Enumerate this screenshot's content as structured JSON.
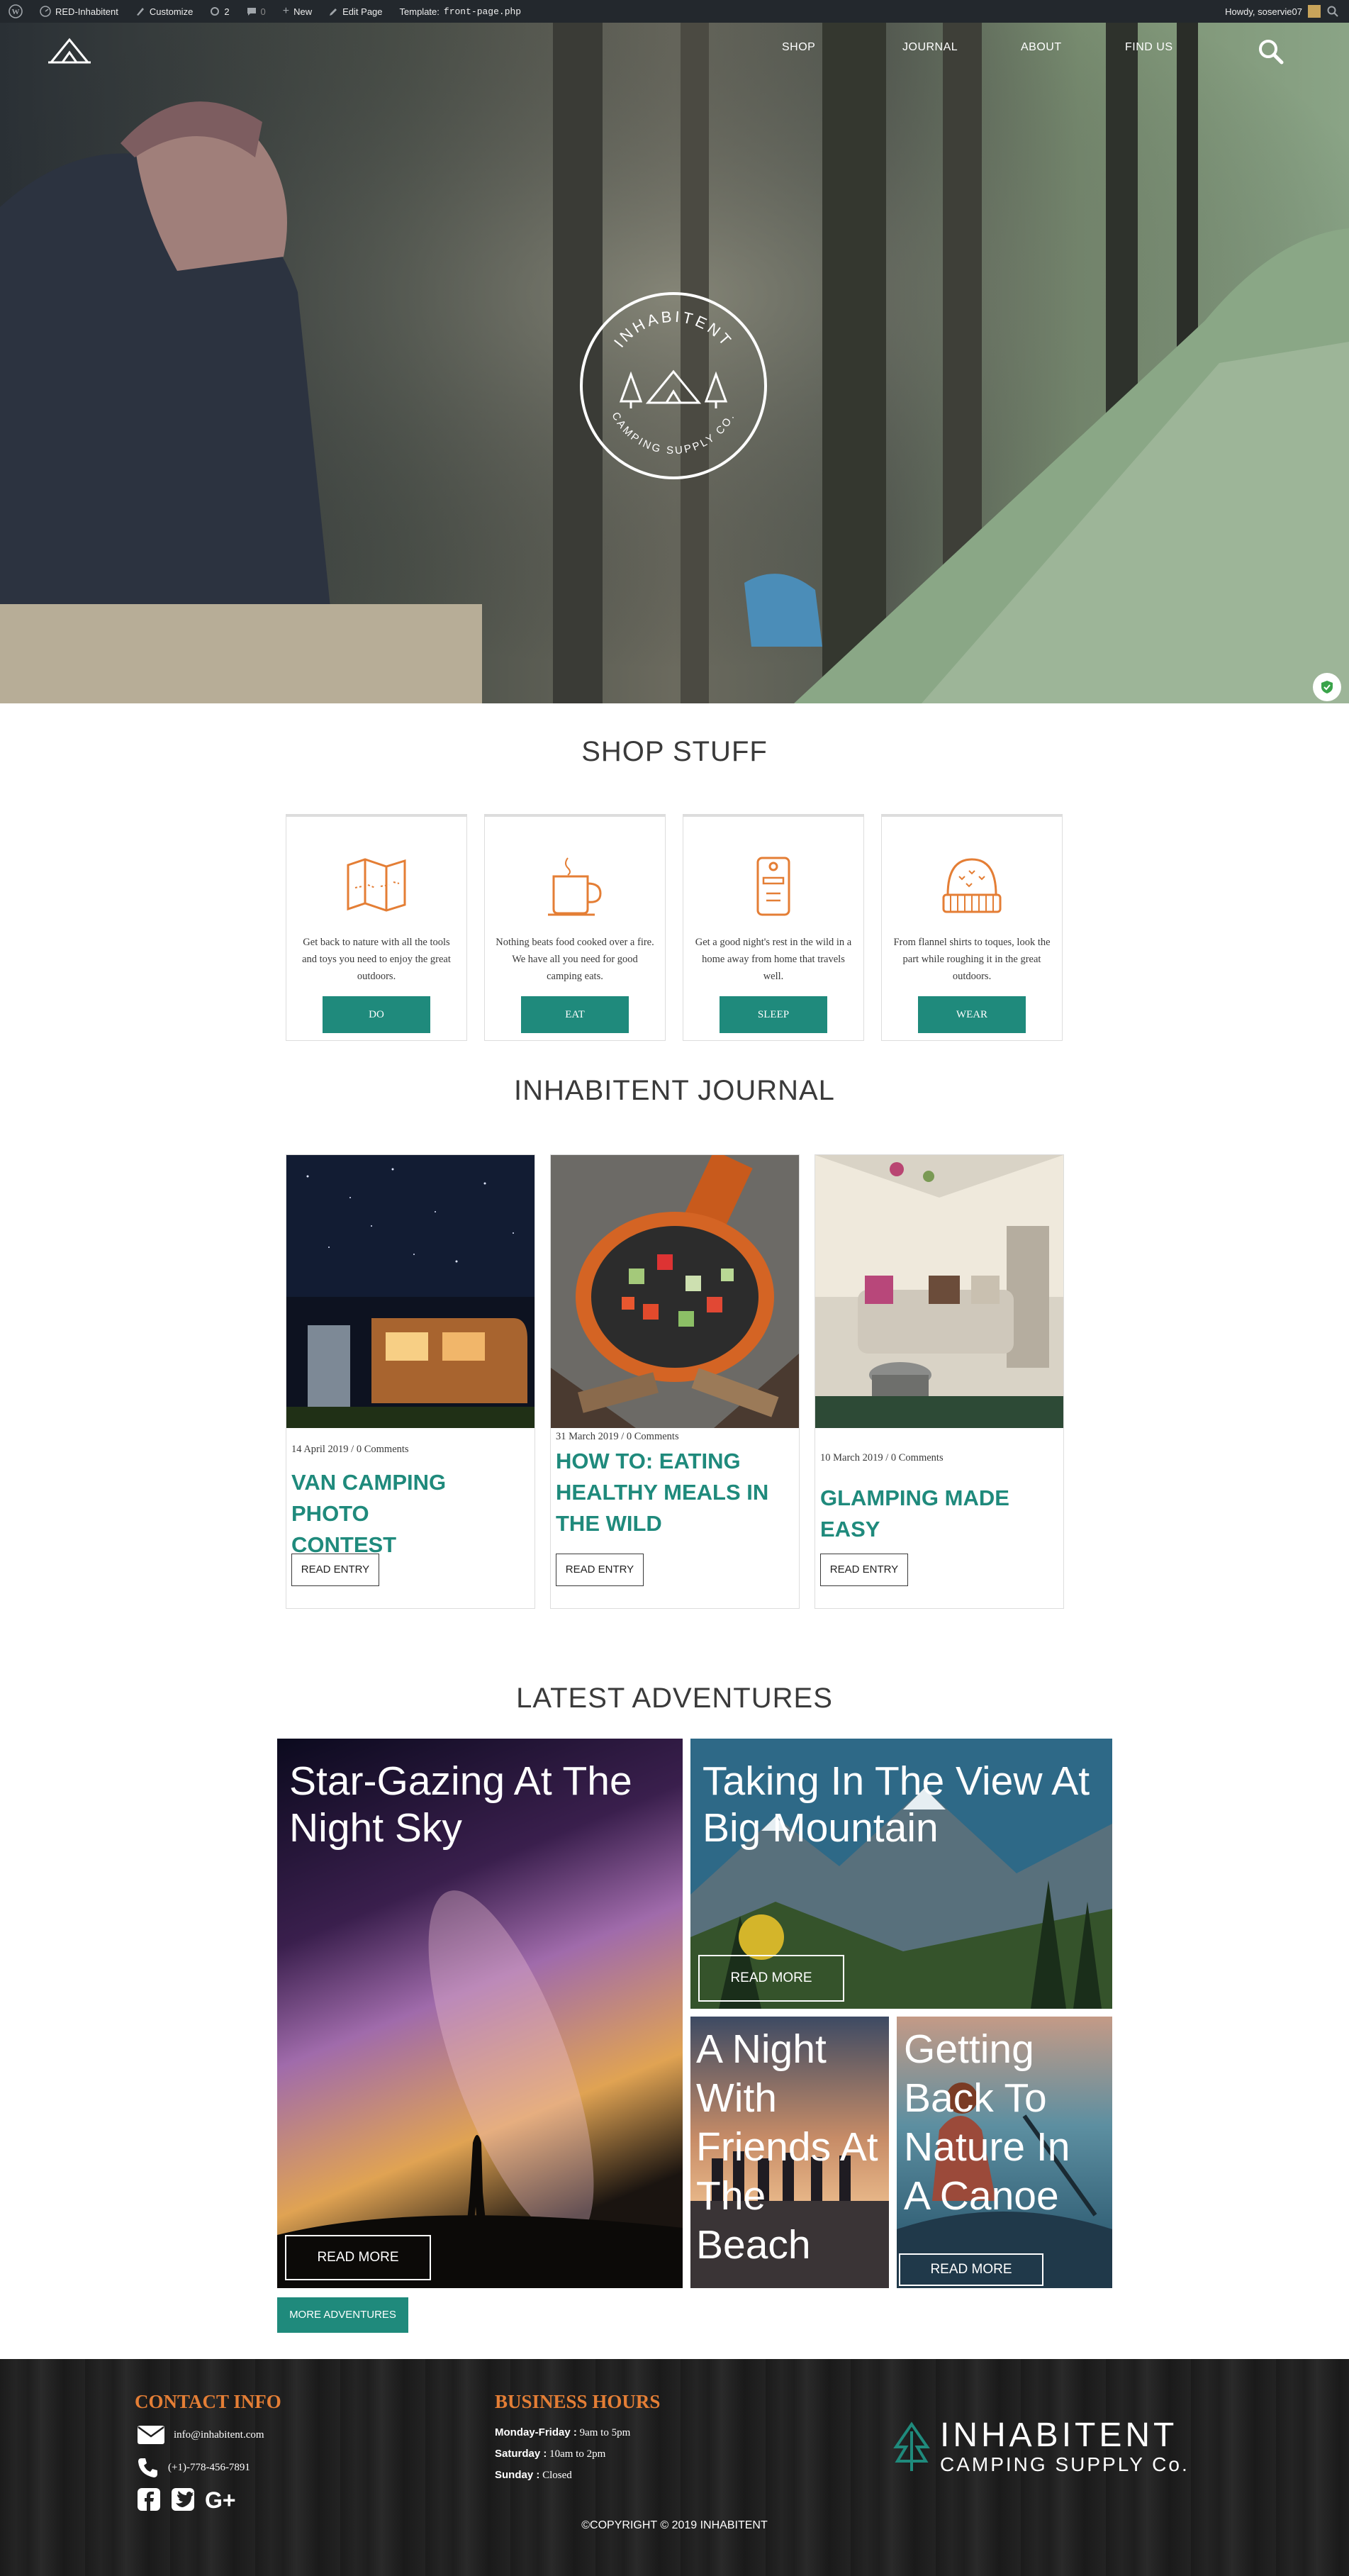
{
  "admin_bar": {
    "site_name": "RED-Inhabitent",
    "customize": "Customize",
    "updates_count": "2",
    "comments_count": "0",
    "new": "New",
    "edit_page": "Edit Page",
    "template_label": "Template:",
    "template_file": "front-page.php",
    "howdy": "Howdy, soservie07"
  },
  "nav": {
    "items": [
      {
        "label": "SHOP"
      },
      {
        "label": "JOURNAL"
      },
      {
        "label": "ABOUT"
      },
      {
        "label": "FIND US"
      }
    ]
  },
  "hero": {
    "badge_top": "INHABITENT",
    "badge_bottom": "CAMPING SUPPLY CO."
  },
  "shop": {
    "title": "SHOP STUFF",
    "cards": [
      {
        "icon": "map-icon",
        "text": "Get back to nature with all the tools and toys you need to enjoy the great outdoors.",
        "button": "DO"
      },
      {
        "icon": "mug-icon",
        "text": "Nothing beats food cooked over a fire. We have all you need for good camping eats.",
        "button": "EAT"
      },
      {
        "icon": "sleep-tag-icon",
        "text": "Get a good night's rest in the wild in a home away from home that travels well.",
        "button": "SLEEP"
      },
      {
        "icon": "toque-icon",
        "text": "From flannel shirts to toques, look the part while roughing it in the great outdoors.",
        "button": "WEAR"
      }
    ]
  },
  "journal": {
    "title": "INHABITENT JOURNAL",
    "posts": [
      {
        "meta": "14 April 2019 / 0 Comments",
        "title_lines": [
          "VAN CAMPING PHOTO",
          "CONTEST"
        ],
        "button": "READ ENTRY"
      },
      {
        "meta": "31 March 2019 / 0 Comments",
        "title_lines": [
          "HOW TO: EATING",
          "HEALTHY MEALS IN",
          "THE WILD"
        ],
        "button": "READ ENTRY"
      },
      {
        "meta": "10 March 2019 / 0 Comments",
        "title_lines": [
          "GLAMPING MADE EASY"
        ],
        "button": "READ ENTRY"
      }
    ]
  },
  "adventures": {
    "title": "LATEST ADVENTURES",
    "items": [
      {
        "title_lines": [
          "Star-Gazing At The",
          "Night Sky"
        ],
        "button": "READ MORE"
      },
      {
        "title_lines": [
          "Taking In The View At",
          "Big Mountain"
        ],
        "button": "READ MORE"
      },
      {
        "title_lines": [
          "A Night",
          "With",
          "Friends At",
          "The",
          "Beach"
        ],
        "button": ""
      },
      {
        "title_lines": [
          "Getting",
          "Back To",
          "Nature In",
          "A Canoe"
        ],
        "button": "READ MORE"
      }
    ],
    "more_button": "MORE ADVENTURES"
  },
  "footer": {
    "contact_title": "CONTACT INFO",
    "email": "info@inhabitent.com",
    "phone": "(+1)-778-456-7891",
    "hours_title": "BUSINESS HOURS",
    "hours": [
      {
        "day": "Monday-Friday :",
        "time": "9am to 5pm"
      },
      {
        "day": "Saturday :",
        "time": "10am to 2pm"
      },
      {
        "day": "Sunday :",
        "time": "Closed"
      }
    ],
    "brand_line1": "INHABITENT",
    "brand_line2": "CAMPING SUPPLY Co.",
    "copyright": "©COPYRIGHT © 2019 INHABITENT"
  },
  "colors": {
    "accent": "#1f8a7c",
    "orange": "#e47e35",
    "admin_bar": "#23282d"
  }
}
